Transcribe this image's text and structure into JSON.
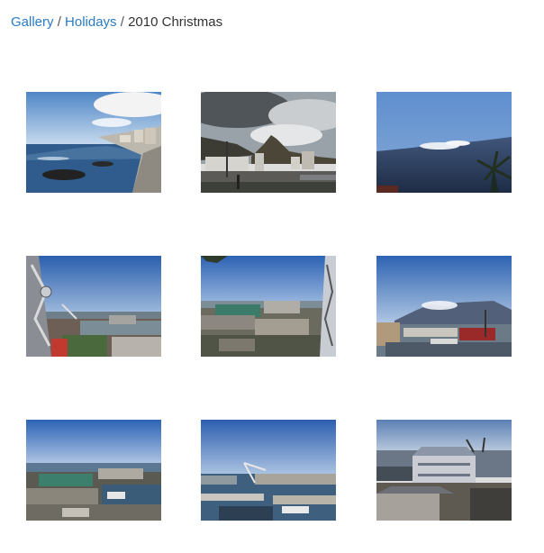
{
  "breadcrumb": {
    "items": [
      {
        "label": "Gallery",
        "link": true
      },
      {
        "label": "Holidays",
        "link": true
      },
      {
        "label": "2010 Christmas",
        "link": false
      }
    ],
    "separator": "/"
  },
  "gallery": {
    "thumbnails": [
      {
        "name": "sea-promenade-photo"
      },
      {
        "name": "lions-head-photo"
      },
      {
        "name": "table-mountain-cloud-photo"
      },
      {
        "name": "wheel-view-harbour-photo"
      },
      {
        "name": "wheel-view-waterfront-photo"
      },
      {
        "name": "table-mountain-harbour-photo"
      },
      {
        "name": "waterfront-aerial-photo"
      },
      {
        "name": "marina-crane-photo"
      },
      {
        "name": "harbour-buildings-photo"
      }
    ]
  }
}
